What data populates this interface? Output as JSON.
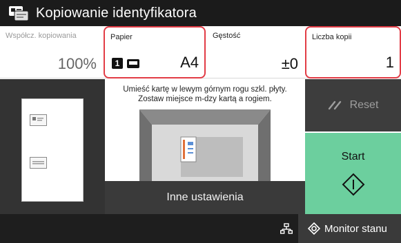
{
  "titlebar": {
    "title": "Kopiowanie identyfikatora",
    "icon": "id-card-copy-icon"
  },
  "settings": {
    "ratio": {
      "label": "Współcz. kopiowania",
      "value": "100%"
    },
    "paper": {
      "label": "Papier",
      "tray_number": "1",
      "tray_icon": "paper-tray-icon",
      "value": "A4"
    },
    "density": {
      "label": "Gęstość",
      "value": "±0"
    },
    "copies": {
      "label": "Liczba kopii",
      "value": "1"
    }
  },
  "guide": {
    "line1": "Umieść kartę w lewym górnym rogu szkl. płyty.",
    "line2": "Zostaw miejsce m-dzy kartą a rogiem."
  },
  "buttons": {
    "reset": "Reset",
    "start": "Start",
    "other_settings": "Inne ustawienia",
    "status_monitor": "Monitor stanu"
  },
  "colors": {
    "highlight": "#e23b45",
    "start": "#6ccf9e",
    "titlebar": "#1b1b1b"
  }
}
